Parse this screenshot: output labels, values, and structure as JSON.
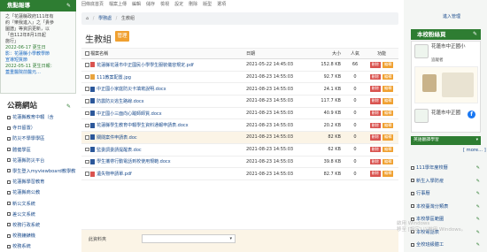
{
  "left": {
    "news_title": "焦點報導",
    "news_lines": [
      {
        "text": "之「花蓮縣政府111年有",
        "cls": ""
      },
      {
        "text": "約『樂我進入』之「貴參",
        "cls": ""
      },
      {
        "text": "圖譜」等資訊更新，以",
        "cls": ""
      },
      {
        "text": "「自112年8月1日起",
        "cls": ""
      },
      {
        "text": "施行」",
        "cls": ""
      },
      {
        "text": "2022-06-17 更生日",
        "cls": "d"
      },
      {
        "text": "影：花蓮縣小學教學節",
        "cls": "t"
      },
      {
        "text": "宣導短質節",
        "cls": "t"
      },
      {
        "text": "2022-05-11 更生日報：",
        "cls": "d"
      },
      {
        "text": "蓋重醫院前醫元…",
        "cls": "t"
      }
    ],
    "public_title": "公務網站",
    "links": [
      "花蓮縣教育中輟（含",
      "寺日留置）",
      "防災不學學學區",
      "體健學區",
      "花蓮縣防災平台",
      "學生登入myviewboard教學教育",
      "花蓮縣學習教育",
      "花蓮縣商公教",
      "新公文系統",
      "差公文系統",
      "校務行政系統",
      "校務鐘錶機",
      "校務系統"
    ]
  },
  "topnav": {
    "items": [
      "回條底首頁",
      "檔案上傳",
      "編輯",
      "儲存",
      "檢視",
      "設定",
      "刪除",
      "版型",
      "選項"
    ]
  },
  "main": {
    "breadcrumb": [
      "首頁",
      "學務處",
      "生教組"
    ],
    "title": "生教組",
    "manage_label": "管理",
    "headers": {
      "name": "檔案名稱",
      "date": "日期",
      "size": "大小",
      "views": "人氣",
      "actions": "功能"
    },
    "delete_label": "刪除",
    "edit_label": "編輯",
    "rows": [
      {
        "name": "花蓮縣花蓮市中正國民小學學生服裝儀容規定.pdf",
        "date": "2021-05-22 14:45:03",
        "size": "152.8 KB",
        "views": "66",
        "icon_color": "#d9534f",
        "hl": false
      },
      {
        "name": "111教案配置.jpg",
        "date": "2021-08-23 14:55:03",
        "size": "92.7 KB",
        "views": "0",
        "icon_color": "#e8a33d",
        "hl": false
      },
      {
        "name": "中正國小家庭防災卡填寫說明.docx",
        "date": "2021-08-23 14:55:03",
        "size": "24.1 KB",
        "views": "0",
        "icon_color": "#2b579a",
        "hl": false
      },
      {
        "name": "防震防災逃生路線.docx",
        "date": "2021-08-23 14:55:03",
        "size": "117.7 KB",
        "views": "0",
        "icon_color": "#2b579a",
        "hl": false
      },
      {
        "name": "中正國小三面向心蹤師師質.docx",
        "date": "2021-08-23 14:55:03",
        "size": "40.9 KB",
        "views": "0",
        "icon_color": "#2b579a",
        "hl": false
      },
      {
        "name": "花蓮縣學生教育中輟學生資料通報申請表.docx",
        "date": "2021-08-23 14:55:03",
        "size": "20.2 KB",
        "views": "0",
        "icon_color": "#2b579a",
        "hl": false
      },
      {
        "name": "關閱案件申請表.doc",
        "date": "2021-08-23 14:55:03",
        "size": "82 KB",
        "views": "0",
        "icon_color": "#2b579a",
        "hl": true
      },
      {
        "name": "監委調委請提醒表.doc",
        "date": "2021-08-23 14:55:03",
        "size": "62 KB",
        "views": "0",
        "icon_color": "#2b579a",
        "hl": false
      },
      {
        "name": "學生攜帶行動電話到校使用規範.docx",
        "date": "2021-08-23 14:55:03",
        "size": "39.8 KB",
        "views": "0",
        "icon_color": "#2b579a",
        "hl": false
      },
      {
        "name": "遺失物申請單.pdf",
        "date": "2021-08-23 14:55:03",
        "size": "82.7 KB",
        "views": "0",
        "icon_color": "#d9534f",
        "hl": false
      }
    ],
    "move_label": "此資料夾",
    "move_placeholder": ""
  },
  "right": {
    "login_label": "進入管理",
    "fb_title": "本校粉絲頁",
    "fb_name": "花蓮市中正國小",
    "fb_fans": "追蹤者",
    "fb_name2": "花蓮市中正國",
    "lang_label": "英語翻譯學習",
    "more_label": "[ more... ]",
    "links": [
      "111學年度校曆",
      "新生入學防疫",
      "行事曆",
      "本校臺灣分類表",
      "本校學區範圍",
      "本校電話表",
      "全校班級體工"
    ]
  },
  "watermark": [
    "啟用 Windows",
    "移至 [設定] 以啟用 Windows。"
  ],
  "colors": {
    "green": "#2e7d32",
    "orange": "#f0a030",
    "red": "#d9534f",
    "link": "#1a4b8c"
  },
  "icons": [
    "home-icon",
    "wrench-icon",
    "facebook-icon",
    "chevron-down-icon",
    "checkbox-icon",
    "pdf-file-icon",
    "image-file-icon",
    "word-file-icon"
  ]
}
